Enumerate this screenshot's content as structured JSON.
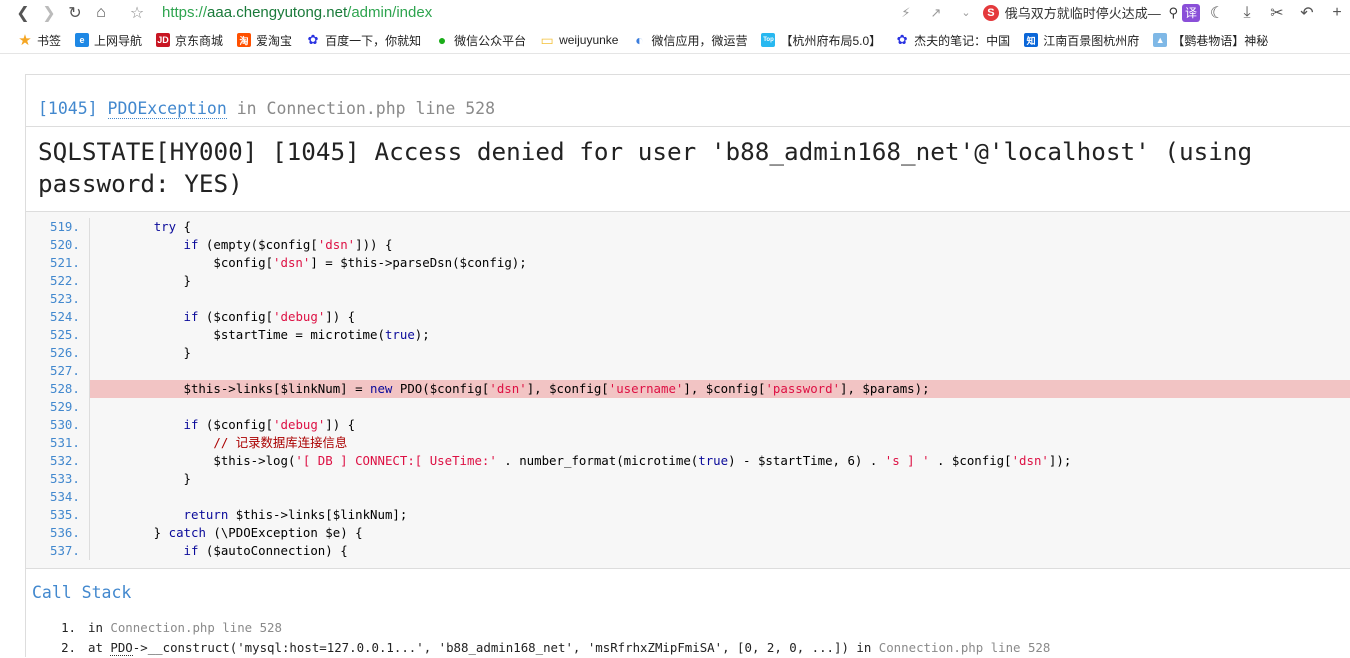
{
  "browser": {
    "url_scheme": "https://",
    "url_host": "aaa.chengyutong.net",
    "url_path": "/admin/index",
    "search_text": "俄乌双方就临时停火达成—",
    "translate_label": "译"
  },
  "bookmarks": [
    {
      "label": "书签",
      "icon": "star-icon",
      "color": "#f5a623"
    },
    {
      "label": "上网导航",
      "icon": "ie-icon",
      "color": "#1e88e5"
    },
    {
      "label": "京东商城",
      "icon": "jd-icon",
      "color": "#c81623"
    },
    {
      "label": "爱淘宝",
      "icon": "taobao-icon",
      "color": "#ff5000"
    },
    {
      "label": "百度一下，你就知",
      "icon": "baidu-icon",
      "color": "#2932e1"
    },
    {
      "label": "微信公众平台",
      "icon": "wechat-icon",
      "color": "#1aad19"
    },
    {
      "label": "weijuyunke",
      "icon": "folder-icon",
      "color": "#f3c13a"
    },
    {
      "label": "微信应用，微运营",
      "icon": "app-icon",
      "color": "#3b7ddd"
    },
    {
      "label": "【杭州府布局5.0】",
      "icon": "top-icon",
      "color": "#28b8f0"
    },
    {
      "label": "杰夫的笔记：中国",
      "icon": "baidu-icon",
      "color": "#2932e1"
    },
    {
      "label": "江南百景图杭州府",
      "icon": "zhihu-icon",
      "color": "#0a66d8"
    },
    {
      "label": "【鹦巷物语】神秘",
      "icon": "game-icon",
      "color": "#7fb8e6"
    }
  ],
  "exception": {
    "code": "[1045]",
    "class_name": "PDOException",
    "in_word": "in",
    "file": "Connection.php",
    "line_text": "line 528",
    "message": "SQLSTATE[HY000] [1045] Access denied for user 'b88_admin168_net'@'localhost' (using password: YES)"
  },
  "source_lines": [
    {
      "n": "519.",
      "code": "        try {"
    },
    {
      "n": "520.",
      "code": "            if (empty($config['dsn'])) {"
    },
    {
      "n": "521.",
      "code": "                $config['dsn'] = $this->parseDsn($config);"
    },
    {
      "n": "522.",
      "code": "            }"
    },
    {
      "n": "523.",
      "code": ""
    },
    {
      "n": "524.",
      "code": "            if ($config['debug']) {"
    },
    {
      "n": "525.",
      "code": "                $startTime = microtime(true);"
    },
    {
      "n": "526.",
      "code": "            }"
    },
    {
      "n": "527.",
      "code": ""
    },
    {
      "n": "528.",
      "code": "            $this->links[$linkNum] = new PDO($config['dsn'], $config['username'], $config['password'], $params);",
      "highlight": true
    },
    {
      "n": "529.",
      "code": ""
    },
    {
      "n": "530.",
      "code": "            if ($config['debug']) {"
    },
    {
      "n": "531.",
      "code": "                // 记录数据库连接信息"
    },
    {
      "n": "532.",
      "code": "                $this->log('[ DB ] CONNECT:[ UseTime:' . number_format(microtime(true) - $startTime, 6) . 's ] ' . $config['dsn']);"
    },
    {
      "n": "533.",
      "code": "            }"
    },
    {
      "n": "534.",
      "code": ""
    },
    {
      "n": "535.",
      "code": "            return $this->links[$linkNum];"
    },
    {
      "n": "536.",
      "code": "        } catch (\\PDOException $e) {"
    },
    {
      "n": "537.",
      "code": "            if ($autoConnection) {"
    }
  ],
  "call_stack": {
    "title": "Call Stack",
    "items": [
      {
        "num": "1.",
        "prefix": "in ",
        "file": "Connection.php line 528",
        "text": ""
      },
      {
        "num": "2.",
        "prefix": "at ",
        "abbr": "PDO",
        "text": "->__construct('mysql:host=127.0.0.1...', 'b88_admin168_net', 'msRfrhxZMipFmiSA', [0, 2, 0, ...]) in ",
        "file": "Connection.php line 528"
      }
    ]
  }
}
